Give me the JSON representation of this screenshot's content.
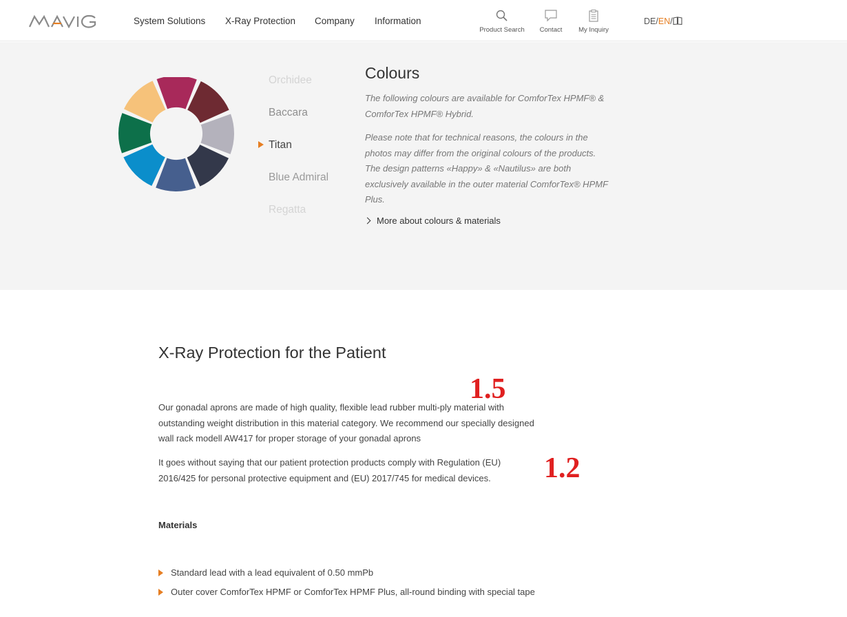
{
  "brand": {
    "logo_text": "MAVIG",
    "accent": "#e67e22"
  },
  "nav": {
    "items": [
      "System Solutions",
      "X-Ray Protection",
      "Company",
      "Information"
    ]
  },
  "tools": [
    {
      "label": "Product Search",
      "icon": "search-icon"
    },
    {
      "label": "Contact",
      "icon": "chat-bubble-icon"
    },
    {
      "label": "My Inquiry",
      "icon": "clipboard-icon"
    }
  ],
  "language": {
    "de": "DE",
    "en": "EN",
    "sep": "/",
    "active": "EN"
  },
  "colours": {
    "title": "Colours",
    "list": [
      "Orchidee",
      "Baccara",
      "Titan",
      "Blue Admiral",
      "Regatta"
    ],
    "selected": "Titan",
    "text1": "The following colours are available for ComforTex HPMF® & ComforTex HPMF® Hybrid.",
    "text2": "Please note that for technical reasons, the colours in the photos may differ from the original colours of the products. The design patterns «Happy» & «Nautilus» are both exclusively available in the outer material ComforTex® HPMF Plus.",
    "link": "More about colours & materials",
    "swatches": [
      "#a8295a",
      "#6e2a32",
      "#b4b2bc",
      "#33384a",
      "#465f8e",
      "#0b8ecb",
      "#0d704a",
      "#f6c27a"
    ]
  },
  "patient": {
    "title": "X-Ray Protection for the Patient",
    "para1": "Our gonadal aprons are made of high quality, flexible lead rubber multi-ply material with outstanding weight distribution in this material category. We recommend our specially designed wall rack modell AW417 for proper storage of your gonadal aprons",
    "para2": "It goes without saying that our patient protection products comply with Regulation (EU) 2016/425 for personal protective equipment and (EU) 2017/745 for medical devices.",
    "annot1": "1.5",
    "annot2": "1.2",
    "materials_title": "Materials",
    "materials": [
      "Standard lead with a lead equivalent of 0.50 mmPb",
      "Outer cover ComforTex HPMF or ComforTex HPMF Plus, all-round binding with special tape"
    ]
  }
}
